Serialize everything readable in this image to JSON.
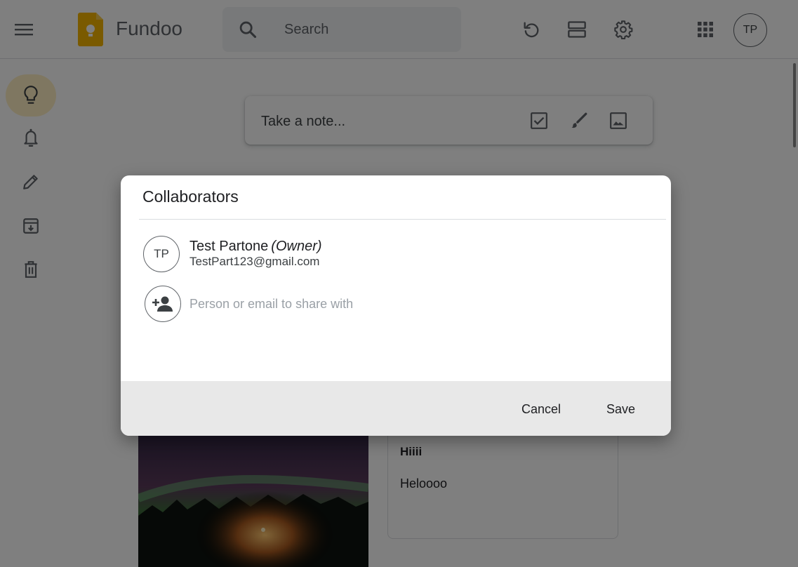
{
  "header": {
    "app_title": "Fundoo",
    "search_placeholder": "Search",
    "icons": [
      "menu-icon",
      "keep-logo-icon",
      "search-icon",
      "refresh-icon",
      "list-view-icon",
      "settings-icon",
      "apps-grid-icon"
    ],
    "user_initials": "TP"
  },
  "sidebar": {
    "items": [
      {
        "name": "notes",
        "icon": "lightbulb-icon",
        "active": true
      },
      {
        "name": "reminders",
        "icon": "bell-icon",
        "active": false
      },
      {
        "name": "edit-labels",
        "icon": "pencil-icon",
        "active": false
      },
      {
        "name": "archive",
        "icon": "archive-icon",
        "active": false
      },
      {
        "name": "trash",
        "icon": "trash-icon",
        "active": false
      }
    ],
    "active_color": "#feefc3"
  },
  "take_note": {
    "placeholder": "Take a note...",
    "icons": [
      "checkbox-icon",
      "brush-icon",
      "image-icon"
    ]
  },
  "notes": [
    {
      "type": "image",
      "description_icon": "aurora-photo"
    },
    {
      "type": "text",
      "title": "Hiiii",
      "body": "Heloooo"
    }
  ],
  "dialog": {
    "title": "Collaborators",
    "owner": {
      "initials": "TP",
      "name": "Test Partone",
      "role": "(Owner)",
      "email": "TestPart123@gmail.com"
    },
    "share_placeholder": "Person or email to share with",
    "cancel_label": "Cancel",
    "save_label": "Save",
    "footer_color": "#e8e8e8"
  }
}
